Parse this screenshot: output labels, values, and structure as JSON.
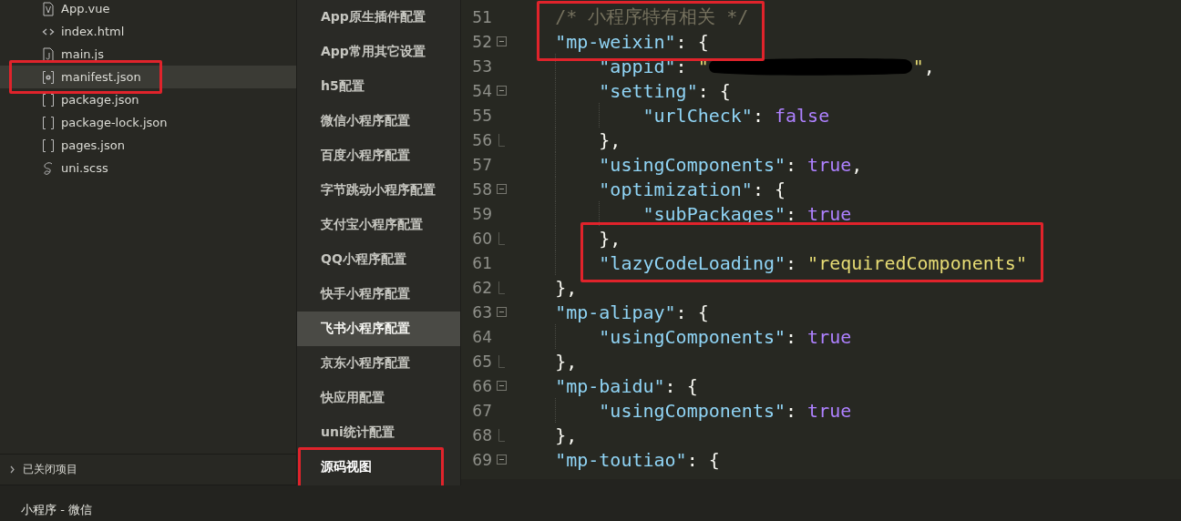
{
  "files": [
    {
      "name": "App.vue",
      "kind": "vue",
      "selected": false,
      "outlined": false
    },
    {
      "name": "index.html",
      "kind": "html",
      "selected": false,
      "outlined": false
    },
    {
      "name": "main.js",
      "kind": "js",
      "selected": false,
      "outlined": false
    },
    {
      "name": "manifest.json",
      "kind": "config",
      "selected": true,
      "outlined": true
    },
    {
      "name": "package.json",
      "kind": "json",
      "selected": false,
      "outlined": false
    },
    {
      "name": "package-lock.json",
      "kind": "json",
      "selected": false,
      "outlined": false
    },
    {
      "name": "pages.json",
      "kind": "json",
      "selected": false,
      "outlined": false
    },
    {
      "name": "uni.scss",
      "kind": "scss",
      "selected": false,
      "outlined": false
    }
  ],
  "closed_projects": {
    "label": "已关闭项目",
    "expanded": false
  },
  "config_nav": [
    {
      "label": "App原生插件配置",
      "selected": false,
      "active": false,
      "outlined": false
    },
    {
      "label": "App常用其它设置",
      "selected": false,
      "active": false,
      "outlined": false
    },
    {
      "label": "h5配置",
      "selected": false,
      "active": false,
      "outlined": false
    },
    {
      "label": "微信小程序配置",
      "selected": false,
      "active": false,
      "outlined": false
    },
    {
      "label": "百度小程序配置",
      "selected": false,
      "active": false,
      "outlined": false
    },
    {
      "label": "字节跳动小程序配置",
      "selected": false,
      "active": false,
      "outlined": false
    },
    {
      "label": "支付宝小程序配置",
      "selected": false,
      "active": false,
      "outlined": false
    },
    {
      "label": "QQ小程序配置",
      "selected": false,
      "active": false,
      "outlined": false
    },
    {
      "label": "快手小程序配置",
      "selected": false,
      "active": false,
      "outlined": false
    },
    {
      "label": "飞书小程序配置",
      "selected": true,
      "active": false,
      "outlined": false
    },
    {
      "label": "京东小程序配置",
      "selected": false,
      "active": false,
      "outlined": false
    },
    {
      "label": "快应用配置",
      "selected": false,
      "active": false,
      "outlined": false
    },
    {
      "label": "uni统计配置",
      "selected": false,
      "active": false,
      "outlined": false
    },
    {
      "label": "源码视图",
      "selected": false,
      "active": true,
      "outlined": true
    }
  ],
  "editor": {
    "lines": [
      {
        "number": "51",
        "fold_open": false,
        "fold_end": false,
        "outlined": true,
        "tokens": [
          {
            "kind": "comment",
            "text": "/* 小程序特有相关 */"
          }
        ]
      },
      {
        "number": "52",
        "fold_open": true,
        "fold_end": false,
        "outlined": true,
        "tokens": [
          {
            "kind": "key",
            "text": "\"mp-weixin\""
          },
          {
            "kind": "punct",
            "text": ": {"
          }
        ]
      },
      {
        "number": "53",
        "fold_open": false,
        "fold_end": false,
        "outlined": false,
        "tokens": [
          {
            "kind": "key",
            "text": "\"appid\""
          },
          {
            "kind": "punct",
            "text": ": "
          },
          {
            "kind": "string",
            "text": "\""
          },
          {
            "kind": "redaction"
          },
          {
            "kind": "string",
            "text": "\""
          },
          {
            "kind": "punct",
            "text": ","
          }
        ]
      },
      {
        "number": "54",
        "fold_open": true,
        "fold_end": false,
        "outlined": false,
        "tokens": [
          {
            "kind": "key",
            "text": "\"setting\""
          },
          {
            "kind": "punct",
            "text": ": {"
          }
        ]
      },
      {
        "number": "55",
        "fold_open": false,
        "fold_end": false,
        "outlined": false,
        "tokens": [
          {
            "kind": "key",
            "text": "\"urlCheck\""
          },
          {
            "kind": "punct",
            "text": ": "
          },
          {
            "kind": "bool",
            "text": "false"
          }
        ]
      },
      {
        "number": "56",
        "fold_open": false,
        "fold_end": true,
        "outlined": false,
        "tokens": [
          {
            "kind": "punct",
            "text": "},"
          }
        ]
      },
      {
        "number": "57",
        "fold_open": false,
        "fold_end": false,
        "outlined": false,
        "tokens": [
          {
            "kind": "key",
            "text": "\"usingComponents\""
          },
          {
            "kind": "punct",
            "text": ": "
          },
          {
            "kind": "bool",
            "text": "true"
          },
          {
            "kind": "punct",
            "text": ","
          }
        ]
      },
      {
        "number": "58",
        "fold_open": true,
        "fold_end": false,
        "outlined": false,
        "tokens": [
          {
            "kind": "key",
            "text": "\"optimization\""
          },
          {
            "kind": "punct",
            "text": ": {"
          }
        ]
      },
      {
        "number": "59",
        "fold_open": false,
        "fold_end": false,
        "outlined": false,
        "tokens": [
          {
            "kind": "key",
            "text": "\"subPackages\""
          },
          {
            "kind": "punct",
            "text": ": "
          },
          {
            "kind": "bool",
            "text": "true"
          }
        ]
      },
      {
        "number": "60",
        "fold_open": false,
        "fold_end": true,
        "outlined": true,
        "tokens": [
          {
            "kind": "punct",
            "text": "},"
          }
        ]
      },
      {
        "number": "61",
        "fold_open": false,
        "fold_end": false,
        "outlined": true,
        "tokens": [
          {
            "kind": "key",
            "text": "\"lazyCodeLoading\""
          },
          {
            "kind": "punct",
            "text": ": "
          },
          {
            "kind": "string",
            "text": "\"requiredComponents\""
          }
        ]
      },
      {
        "number": "62",
        "fold_open": false,
        "fold_end": true,
        "outlined": false,
        "tokens": [
          {
            "kind": "punct",
            "text": "},"
          }
        ]
      },
      {
        "number": "63",
        "fold_open": true,
        "fold_end": false,
        "outlined": false,
        "tokens": [
          {
            "kind": "key",
            "text": "\"mp-alipay\""
          },
          {
            "kind": "punct",
            "text": ": {"
          }
        ]
      },
      {
        "number": "64",
        "fold_open": false,
        "fold_end": false,
        "outlined": false,
        "tokens": [
          {
            "kind": "key",
            "text": "\"usingComponents\""
          },
          {
            "kind": "punct",
            "text": ": "
          },
          {
            "kind": "bool",
            "text": "true"
          }
        ]
      },
      {
        "number": "65",
        "fold_open": false,
        "fold_end": true,
        "outlined": false,
        "tokens": [
          {
            "kind": "punct",
            "text": "},"
          }
        ]
      },
      {
        "number": "66",
        "fold_open": true,
        "fold_end": false,
        "outlined": false,
        "tokens": [
          {
            "kind": "key",
            "text": "\"mp-baidu\""
          },
          {
            "kind": "punct",
            "text": ": {"
          }
        ]
      },
      {
        "number": "67",
        "fold_open": false,
        "fold_end": false,
        "outlined": false,
        "tokens": [
          {
            "kind": "key",
            "text": "\"usingComponents\""
          },
          {
            "kind": "punct",
            "text": ": "
          },
          {
            "kind": "bool",
            "text": "true"
          }
        ]
      },
      {
        "number": "68",
        "fold_open": false,
        "fold_end": true,
        "outlined": false,
        "tokens": [
          {
            "kind": "punct",
            "text": "},"
          }
        ]
      },
      {
        "number": "69",
        "fold_open": true,
        "fold_end": false,
        "outlined": false,
        "tokens": [
          {
            "kind": "key",
            "text": "\"mp-toutiao\""
          },
          {
            "kind": "punct",
            "text": ": {"
          }
        ]
      }
    ]
  },
  "status_bar": {
    "text": "小程序 - 微信"
  }
}
